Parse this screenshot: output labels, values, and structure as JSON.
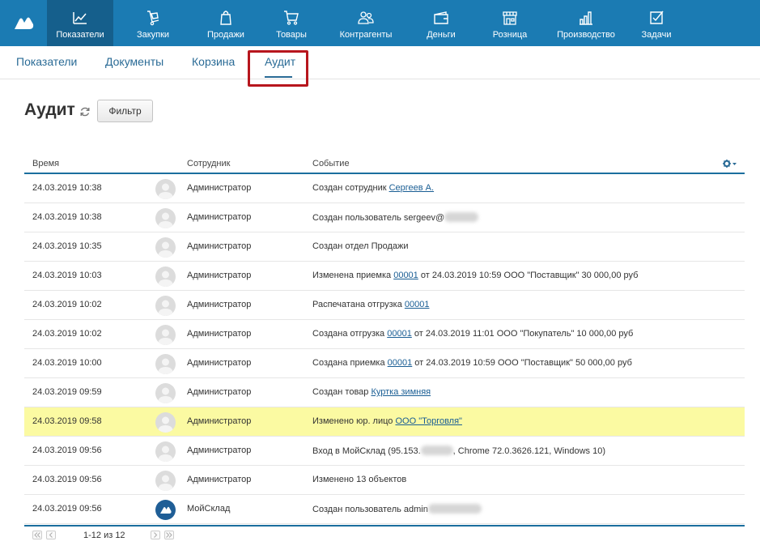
{
  "nav": {
    "items": [
      {
        "label": "Показатели",
        "icon": "chart-line-icon"
      },
      {
        "label": "Закупки",
        "icon": "cart-dolly-icon"
      },
      {
        "label": "Продажи",
        "icon": "shopping-bag-icon"
      },
      {
        "label": "Товары",
        "icon": "shopping-cart-icon"
      },
      {
        "label": "Контрагенты",
        "icon": "people-icon"
      },
      {
        "label": "Деньги",
        "icon": "wallet-icon"
      },
      {
        "label": "Розница",
        "icon": "store-icon"
      },
      {
        "label": "Производство",
        "icon": "factory-icon"
      },
      {
        "label": "Задачи",
        "icon": "checkbox-icon"
      }
    ],
    "active": "Показатели"
  },
  "subnav": {
    "tabs": [
      "Показатели",
      "Документы",
      "Корзина",
      "Аудит"
    ],
    "active": "Аудит"
  },
  "page": {
    "title": "Аудит",
    "filter_label": "Фильтр"
  },
  "table": {
    "headers": {
      "time": "Время",
      "employee": "Сотрудник",
      "event": "Событие"
    },
    "rows": [
      {
        "time": "24.03.2019 10:38",
        "employee": "Администратор",
        "event_text": "Создан сотрудник ",
        "event_link": "Сергеев А.",
        "event_suffix": ""
      },
      {
        "time": "24.03.2019 10:38",
        "employee": "Администратор",
        "event_text": "Создан пользователь sergeev@",
        "event_link": "",
        "event_suffix": ""
      },
      {
        "time": "24.03.2019 10:35",
        "employee": "Администратор",
        "event_text": "Создан отдел Продажи",
        "event_link": "",
        "event_suffix": ""
      },
      {
        "time": "24.03.2019 10:03",
        "employee": "Администратор",
        "event_text": "Изменена приемка ",
        "event_link": "00001",
        "event_suffix": " от 24.03.2019 10:59 ООО \"Поставщик\" 30 000,00 руб"
      },
      {
        "time": "24.03.2019 10:02",
        "employee": "Администратор",
        "event_text": "Распечатана отгрузка ",
        "event_link": "00001",
        "event_suffix": ""
      },
      {
        "time": "24.03.2019 10:02",
        "employee": "Администратор",
        "event_text": "Создана отгрузка ",
        "event_link": "00001",
        "event_suffix": " от 24.03.2019 11:01 ООО \"Покупатель\" 10 000,00 руб"
      },
      {
        "time": "24.03.2019 10:00",
        "employee": "Администратор",
        "event_text": "Создана приемка ",
        "event_link": "00001",
        "event_suffix": " от 24.03.2019 10:59 ООО \"Поставщик\" 50 000,00 руб"
      },
      {
        "time": "24.03.2019 09:59",
        "employee": "Администратор",
        "event_text": "Создан товар ",
        "event_link": "Куртка зимняя",
        "event_suffix": ""
      },
      {
        "time": "24.03.2019 09:58",
        "employee": "Администратор",
        "event_text": "Изменено юр. лицо ",
        "event_link": "ООО \"Торговля\"",
        "event_suffix": "",
        "highlight": true
      },
      {
        "time": "24.03.2019 09:56",
        "employee": "Администратор",
        "event_text": "Вход в МойСклад (95.153.",
        "event_link": "",
        "event_suffix": ", Chrome 72.0.3626.121, Windows 10)"
      },
      {
        "time": "24.03.2019 09:56",
        "employee": "Администратор",
        "event_text": "Изменено 13 объектов",
        "event_link": "",
        "event_suffix": ""
      },
      {
        "time": "24.03.2019 09:56",
        "employee": "МойСклад",
        "event_text": "Создан пользователь admin",
        "event_link": "",
        "event_suffix": "",
        "brand_avatar": true
      }
    ]
  },
  "pagination": {
    "range_text": "1-12 из 12"
  },
  "colors": {
    "nav_bg": "#1b7bb3",
    "nav_active": "#155f8c",
    "link": "#1a5e94",
    "highlight_row": "#fbfaa2",
    "callout_border": "#b7161d"
  }
}
